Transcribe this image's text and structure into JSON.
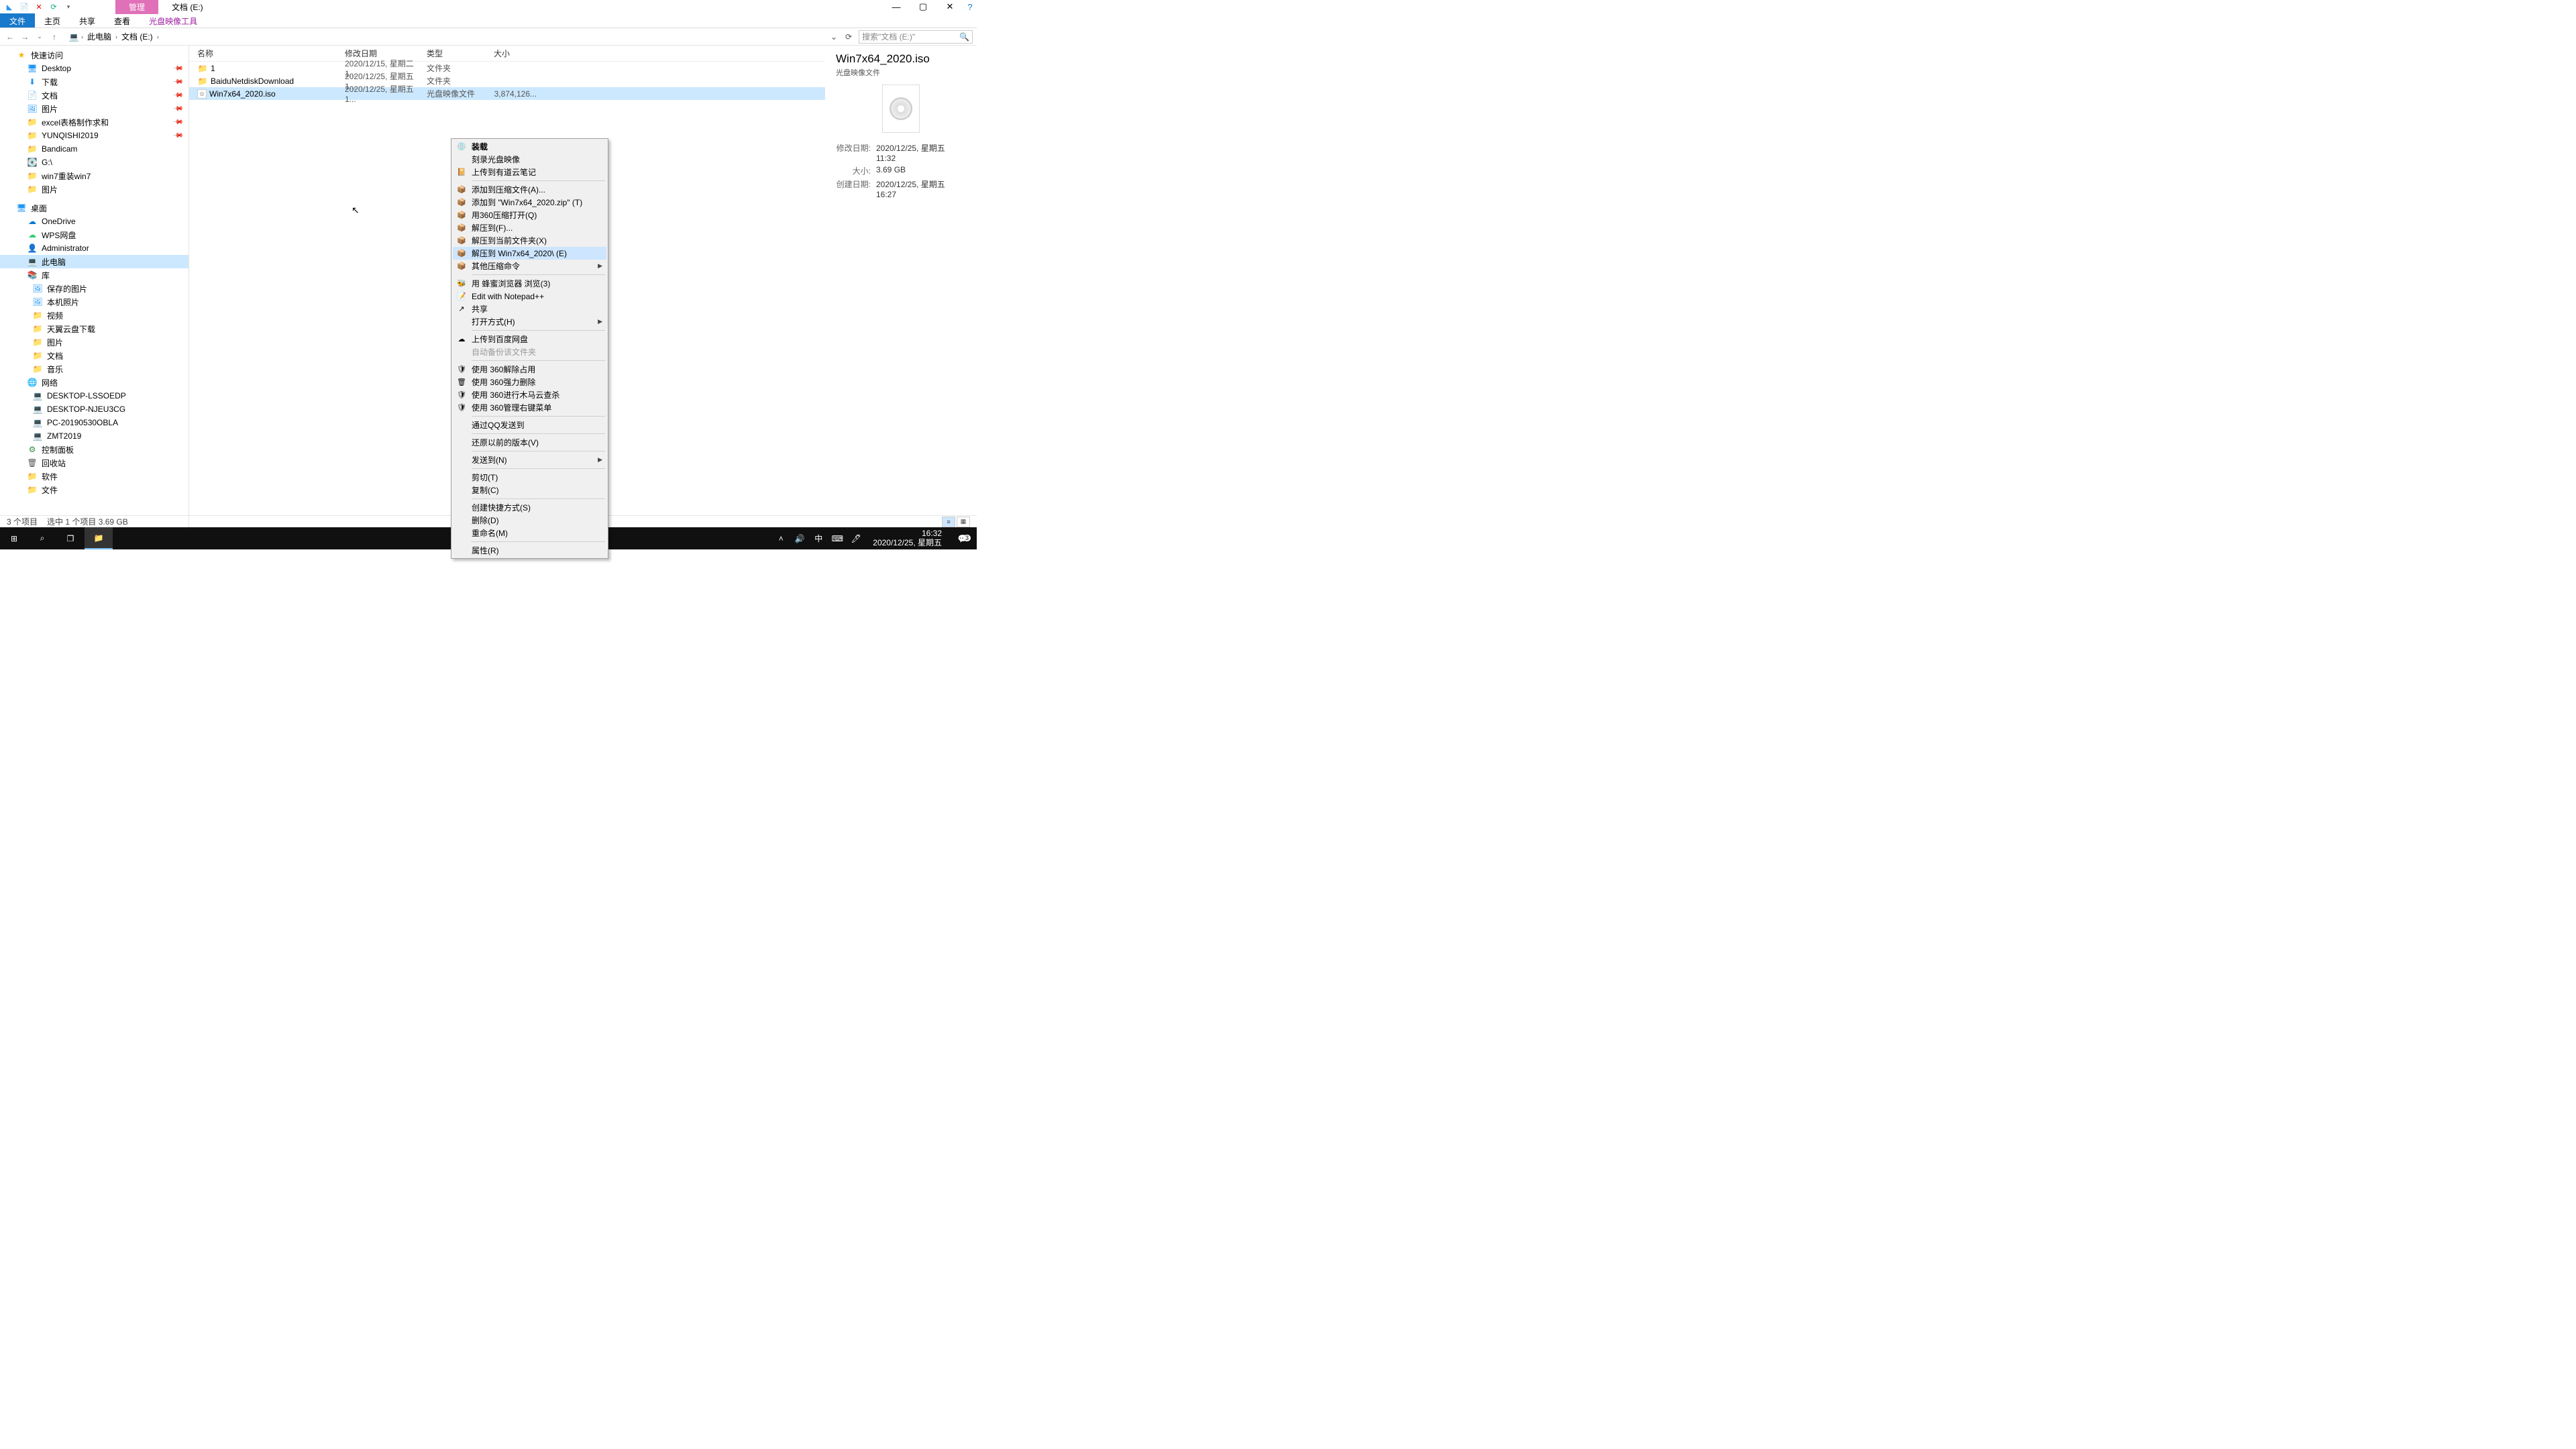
{
  "titlebar": {
    "qat_save": "💾",
    "qat_new": "📄",
    "qat_close": "✕",
    "qat_refresh": "⟳",
    "tab_manage": "管理",
    "tab_location": "文档 (E:)"
  },
  "win": {
    "min": "—",
    "max": "▢",
    "close": "✕",
    "help": "?"
  },
  "ribbon": {
    "file": "文件",
    "home": "主页",
    "share": "共享",
    "view": "查看",
    "iso_tools": "光盘映像工具"
  },
  "nav": {
    "back": "←",
    "fwd": "→",
    "drop": "⌄",
    "up": "↑",
    "pc_icon": "💻",
    "crumbs": [
      "此电脑",
      "文档 (E:)"
    ],
    "search_placeholder": "搜索\"文档 (E:)\"",
    "refresh": "⟳"
  },
  "tree": [
    {
      "icon": "★",
      "cls": "ico-star",
      "label": "快速访问",
      "lvl": 1
    },
    {
      "icon": "🖥",
      "cls": "ico-desk",
      "label": "Desktop",
      "lvl": 2,
      "pin": true
    },
    {
      "icon": "⬇",
      "cls": "ico-desk",
      "label": "下载",
      "lvl": 2,
      "pin": true
    },
    {
      "icon": "📄",
      "cls": "ico-fold",
      "label": "文档",
      "lvl": 2,
      "pin": true
    },
    {
      "icon": "🖼",
      "cls": "ico-pic",
      "label": "图片",
      "lvl": 2,
      "pin": true
    },
    {
      "icon": "📁",
      "cls": "ico-fold",
      "label": "excel表格制作求和",
      "lvl": 2,
      "pin": true
    },
    {
      "icon": "📁",
      "cls": "ico-fold",
      "label": "YUNQISHI2019",
      "lvl": 2,
      "pin": true
    },
    {
      "icon": "📁",
      "cls": "ico-fold",
      "label": "Bandicam",
      "lvl": 2
    },
    {
      "icon": "💽",
      "cls": "ico-disk",
      "label": "G:\\",
      "lvl": 2
    },
    {
      "icon": "📁",
      "cls": "ico-fold",
      "label": "win7重装win7",
      "lvl": 2
    },
    {
      "icon": "📁",
      "cls": "ico-fold",
      "label": "图片",
      "lvl": 2
    },
    {
      "icon": "🖥",
      "cls": "ico-desk",
      "label": "桌面",
      "lvl": 1
    },
    {
      "icon": "☁",
      "cls": "ico-one",
      "label": "OneDrive",
      "lvl": 2
    },
    {
      "icon": "☁",
      "cls": "ico-cloud",
      "label": "WPS网盘",
      "lvl": 2
    },
    {
      "icon": "👤",
      "cls": "ico-user",
      "label": "Administrator",
      "lvl": 2
    },
    {
      "icon": "💻",
      "cls": "ico-pc",
      "label": "此电脑",
      "lvl": 2,
      "selected": true
    },
    {
      "icon": "📚",
      "cls": "ico-lib",
      "label": "库",
      "lvl": 2
    },
    {
      "icon": "🖼",
      "cls": "ico-pic",
      "label": "保存的图片",
      "lvl": 2,
      "sub": true
    },
    {
      "icon": "🖼",
      "cls": "ico-pic",
      "label": "本机照片",
      "lvl": 2,
      "sub": true
    },
    {
      "icon": "📁",
      "cls": "ico-fold",
      "label": "视频",
      "lvl": 2,
      "sub": true
    },
    {
      "icon": "📁",
      "cls": "ico-fold",
      "label": "天翼云盘下载",
      "lvl": 2,
      "sub": true
    },
    {
      "icon": "📁",
      "cls": "ico-fold",
      "label": "图片",
      "lvl": 2,
      "sub": true
    },
    {
      "icon": "📁",
      "cls": "ico-fold",
      "label": "文档",
      "lvl": 2,
      "sub": true
    },
    {
      "icon": "📁",
      "cls": "ico-fold",
      "label": "音乐",
      "lvl": 2,
      "sub": true
    },
    {
      "icon": "🌐",
      "cls": "ico-net",
      "label": "网络",
      "lvl": 2
    },
    {
      "icon": "💻",
      "cls": "ico-pc",
      "label": "DESKTOP-LSSOEDP",
      "lvl": 2,
      "sub": true
    },
    {
      "icon": "💻",
      "cls": "ico-pc",
      "label": "DESKTOP-NJEU3CG",
      "lvl": 2,
      "sub": true
    },
    {
      "icon": "💻",
      "cls": "ico-pc",
      "label": "PC-20190530OBLA",
      "lvl": 2,
      "sub": true
    },
    {
      "icon": "💻",
      "cls": "ico-pc",
      "label": "ZMT2019",
      "lvl": 2,
      "sub": true
    },
    {
      "icon": "⚙",
      "cls": "ico-cpl",
      "label": "控制面板",
      "lvl": 2
    },
    {
      "icon": "🗑",
      "cls": "ico-recycle",
      "label": "回收站",
      "lvl": 2
    },
    {
      "icon": "📁",
      "cls": "ico-fold",
      "label": "软件",
      "lvl": 2
    },
    {
      "icon": "📁",
      "cls": "ico-fold",
      "label": "文件",
      "lvl": 2
    }
  ],
  "columns": {
    "name": "名称",
    "date": "修改日期",
    "type": "类型",
    "size": "大小"
  },
  "files": [
    {
      "icon": "📁",
      "cls": "f-folder",
      "name": "1",
      "date": "2020/12/15, 星期二 1...",
      "type": "文件夹",
      "size": ""
    },
    {
      "icon": "📁",
      "cls": "f-folder",
      "name": "BaiduNetdiskDownload",
      "date": "2020/12/25, 星期五 1...",
      "type": "文件夹",
      "size": ""
    },
    {
      "icon": "◎",
      "cls": "f-iso",
      "name": "Win7x64_2020.iso",
      "date": "2020/12/25, 星期五 1...",
      "type": "光盘映像文件",
      "size": "3,874,126...",
      "selected": true
    }
  ],
  "details": {
    "title": "Win7x64_2020.iso",
    "subtitle": "光盘映像文件",
    "rows": [
      {
        "label": "修改日期:",
        "value": "2020/12/25, 星期五 11:32"
      },
      {
        "label": "大小:",
        "value": "3.69 GB"
      },
      {
        "label": "创建日期:",
        "value": "2020/12/25, 星期五 16:27"
      }
    ]
  },
  "ctx": [
    {
      "icon": "💿",
      "label": "装载",
      "bold": true
    },
    {
      "icon": "",
      "label": "刻录光盘映像"
    },
    {
      "icon": "📔",
      "label": "上传到有道云笔记"
    },
    {
      "sep": true
    },
    {
      "icon": "📦",
      "label": "添加到压缩文件(A)..."
    },
    {
      "icon": "📦",
      "label": "添加到 \"Win7x64_2020.zip\" (T)"
    },
    {
      "icon": "📦",
      "label": "用360压缩打开(Q)"
    },
    {
      "icon": "📦",
      "label": "解压到(F)..."
    },
    {
      "icon": "📦",
      "label": "解压到当前文件夹(X)"
    },
    {
      "icon": "📦",
      "label": "解压到 Win7x64_2020\\ (E)",
      "hl": true
    },
    {
      "icon": "📦",
      "label": "其他压缩命令",
      "arrow": true
    },
    {
      "sep": true
    },
    {
      "icon": "🐝",
      "label": "用 蜂蜜浏览器 浏览(3)"
    },
    {
      "icon": "📝",
      "label": "Edit with Notepad++"
    },
    {
      "icon": "↗",
      "label": "共享"
    },
    {
      "icon": "",
      "label": "打开方式(H)",
      "arrow": true
    },
    {
      "sep": true
    },
    {
      "icon": "☁",
      "label": "上传到百度网盘"
    },
    {
      "icon": "",
      "label": "自动备份该文件夹",
      "disabled": true
    },
    {
      "sep": true
    },
    {
      "icon": "🛡",
      "label": "使用 360解除占用"
    },
    {
      "icon": "🗑",
      "label": "使用 360强力删除"
    },
    {
      "icon": "🛡",
      "label": "使用 360进行木马云查杀"
    },
    {
      "icon": "🛡",
      "label": "使用 360管理右键菜单"
    },
    {
      "sep": true
    },
    {
      "icon": "",
      "label": "通过QQ发送到"
    },
    {
      "sep": true
    },
    {
      "icon": "",
      "label": "还原以前的版本(V)"
    },
    {
      "sep": true
    },
    {
      "icon": "",
      "label": "发送到(N)",
      "arrow": true
    },
    {
      "sep": true
    },
    {
      "icon": "",
      "label": "剪切(T)"
    },
    {
      "icon": "",
      "label": "复制(C)"
    },
    {
      "sep": true
    },
    {
      "icon": "",
      "label": "创建快捷方式(S)"
    },
    {
      "icon": "",
      "label": "删除(D)"
    },
    {
      "icon": "",
      "label": "重命名(M)"
    },
    {
      "sep": true
    },
    {
      "icon": "",
      "label": "属性(R)"
    }
  ],
  "status": {
    "count": "3 个项目",
    "sel": "选中 1 个项目  3.69 GB"
  },
  "taskbar": {
    "time": "16:32",
    "date": "2020/12/25, 星期五",
    "ime": "中",
    "badge": "3"
  }
}
